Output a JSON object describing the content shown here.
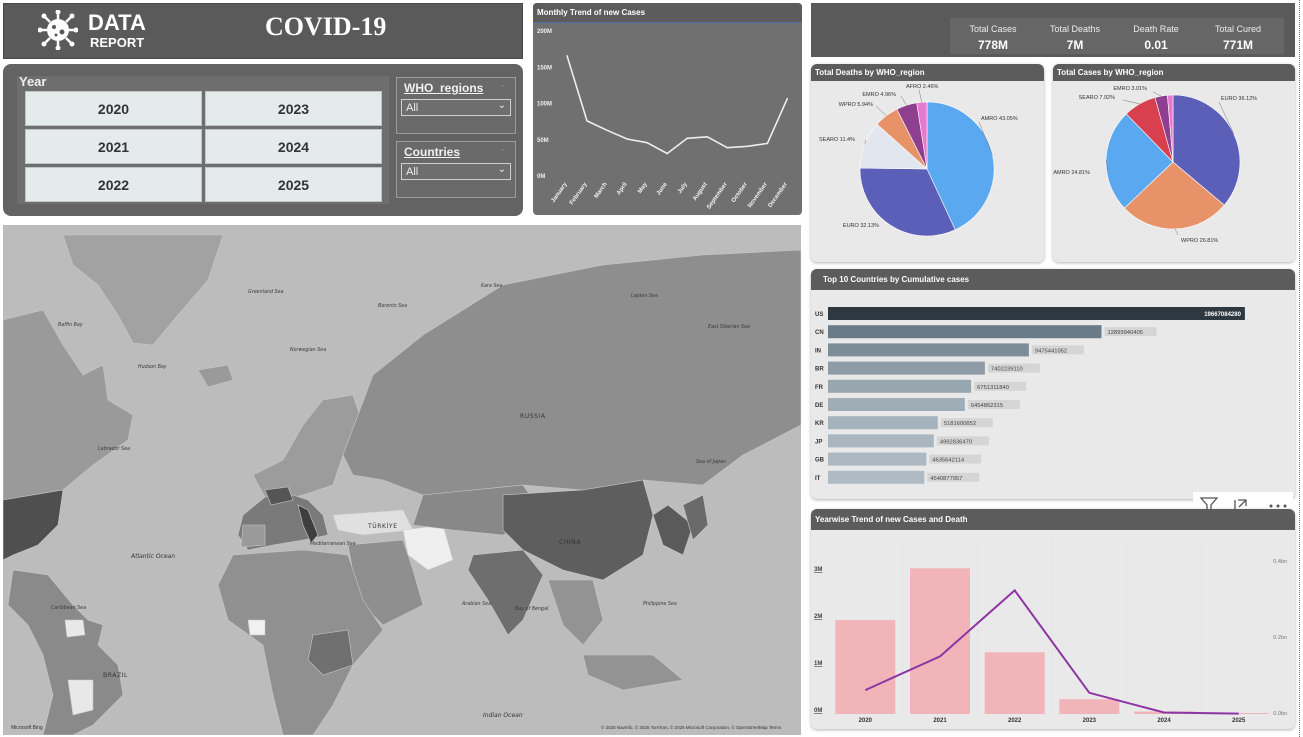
{
  "header": {
    "data_word": "DATA",
    "report_word": "REPORT",
    "title": "COVID-19"
  },
  "slicers": {
    "year_label": "Year",
    "years": [
      "2020",
      "2023",
      "2021",
      "2024",
      "2022",
      "2025"
    ],
    "who_label": "WHO_regions",
    "who_value": "All",
    "countries_label": "Countries",
    "countries_value": "All"
  },
  "kpis": [
    {
      "label": "Total Cases",
      "value": "778M"
    },
    {
      "label": "Total Deaths",
      "value": "7M"
    },
    {
      "label": "Death Rate",
      "value": "0.01"
    },
    {
      "label": "Total Cured",
      "value": "771M"
    }
  ],
  "monthly": {
    "title": "Monthly Trend of new Cases",
    "y_ticks": [
      "200M",
      "150M",
      "100M",
      "50M",
      "0M"
    ]
  },
  "deaths_pie": {
    "title": "Total Deaths by WHO_region"
  },
  "cases_pie": {
    "title": "Total Cases by WHO_region"
  },
  "top10": {
    "title": "Top 10 Countries by Cumulative cases"
  },
  "yearwise": {
    "title": "Yearwise Trend of new Cases and Death",
    "left_ticks": [
      "3M",
      "2M",
      "1M",
      "0M"
    ],
    "right_ticks": [
      "0.4bn",
      "0.2bn",
      "0.0bn"
    ]
  },
  "map": {
    "labels": [
      {
        "text": "Greenland Sea",
        "cls": "sea"
      },
      {
        "text": "Barents Sea",
        "cls": "sea"
      },
      {
        "text": "Kara Sea",
        "cls": "sea"
      },
      {
        "text": "Laptev Sea",
        "cls": "sea"
      },
      {
        "text": "East Siberian Sea",
        "cls": "sea"
      },
      {
        "text": "Baffin Bay",
        "cls": "sea"
      },
      {
        "text": "Norwegian Sea",
        "cls": "sea"
      },
      {
        "text": "RUSSIA",
        "cls": "country"
      },
      {
        "text": "Hudson Bay",
        "cls": "sea"
      },
      {
        "text": "Labrador Sea",
        "cls": "sea"
      },
      {
        "text": "Atlantic Ocean",
        "cls": "ocean"
      },
      {
        "text": "Caribbean Sea",
        "cls": "sea"
      },
      {
        "text": "Mediterranean Sea",
        "cls": "sea"
      },
      {
        "text": "TÜRKİYE",
        "cls": "country"
      },
      {
        "text": "CHINA",
        "cls": "country"
      },
      {
        "text": "Sea of Japan",
        "cls": "sea"
      },
      {
        "text": "Philippine Sea",
        "cls": "sea"
      },
      {
        "text": "Arabian Sea",
        "cls": "sea"
      },
      {
        "text": "Bay of Bengal",
        "cls": "sea"
      },
      {
        "text": "Indian Ocean",
        "cls": "ocean"
      },
      {
        "text": "BRAZIL",
        "cls": "country"
      },
      {
        "text": "Microsoft Bing",
        "cls": "brand"
      },
      {
        "text": "© 2025 NavInfo, © 2025 TomTom, © 2025 Microsoft Corporation, © OpenStreetMap  Terms",
        "cls": "attrib"
      }
    ]
  },
  "chart_data": [
    {
      "type": "line",
      "title": "Monthly Trend of new Cases",
      "categories": [
        "January",
        "February",
        "March",
        "April",
        "May",
        "June",
        "July",
        "August",
        "September",
        "October",
        "November",
        "December"
      ],
      "values": [
        166,
        76,
        63,
        51,
        46,
        31,
        52,
        54,
        39,
        41,
        45,
        107
      ],
      "unit": "M",
      "ylim": [
        0,
        200
      ],
      "color": "#e8f0e8"
    },
    {
      "type": "pie",
      "title": "Total Deaths by WHO_region",
      "slices": [
        {
          "label": "AMRO 43.05%",
          "value": 43.05,
          "color": "#5aa9f0"
        },
        {
          "label": "EURO 32.13%",
          "value": 32.13,
          "color": "#5b5fb8"
        },
        {
          "label": "SEARO 11.4%",
          "value": 11.4,
          "color": "#e2e6ef"
        },
        {
          "label": "WPRO 5.94%",
          "value": 5.94,
          "color": "#e8926a"
        },
        {
          "label": "EMRO 4.96%",
          "value": 4.96,
          "color": "#8f3f8f"
        },
        {
          "label": "AFRO 2.46%",
          "value": 2.46,
          "color": "#e77ad0"
        }
      ]
    },
    {
      "type": "pie",
      "title": "Total Cases by WHO_region",
      "slices": [
        {
          "label": "EURO 36.12%",
          "value": 36.12,
          "color": "#5b5fb8"
        },
        {
          "label": "WPRO 26.81%",
          "value": 26.81,
          "color": "#e8926a"
        },
        {
          "label": "AMRO 24.81%",
          "value": 24.81,
          "color": "#5aa9f0"
        },
        {
          "label": "SEARO 7.92%",
          "value": 7.92,
          "color": "#d9404f"
        },
        {
          "label": "EMRO 3.01%",
          "value": 3.01,
          "color": "#8f3f8f"
        },
        {
          "label": "",
          "value": 1.33,
          "color": "#e77ad0"
        }
      ]
    },
    {
      "type": "bar",
      "title": "Top 10 Countries by Cumulative cases",
      "categories": [
        "US",
        "CN",
        "IN",
        "BR",
        "FR",
        "DE",
        "KR",
        "JP",
        "GB",
        "IT"
      ],
      "values": [
        19667084280,
        12899940405,
        9475441052,
        7402239110,
        6751311840,
        6454862315,
        5181600852,
        4992836470,
        4635642114,
        4540877957
      ],
      "colors": [
        "#2e3840",
        "#6a7b87",
        "#7d8d98",
        "#8d9ca6",
        "#98a6b0",
        "#9fadb7",
        "#a5b3bc",
        "#a9b6bf",
        "#acb9c2",
        "#aebbc4"
      ],
      "xlim": [
        0,
        20000000000
      ]
    },
    {
      "type": "bar",
      "title": "Yearwise Trend of new Cases and Death",
      "categories": [
        "2020",
        "2021",
        "2022",
        "2023",
        "2024",
        "2025"
      ],
      "series": [
        {
          "values": [
            1.9,
            2.95,
            1.25,
            0.3,
            0.05,
            0.02
          ],
          "color": "#f0b4b9"
        },
        {
          "values": [
            0.063,
            0.152,
            0.326,
            0.056,
            0.004,
            0.001
          ],
          "color": "#8e35a3"
        }
      ],
      "left_unit": "M",
      "ylim_left": [
        0,
        3.3
      ],
      "ylim_right": [
        0,
        0.43
      ],
      "right_unit": "bn"
    }
  ]
}
